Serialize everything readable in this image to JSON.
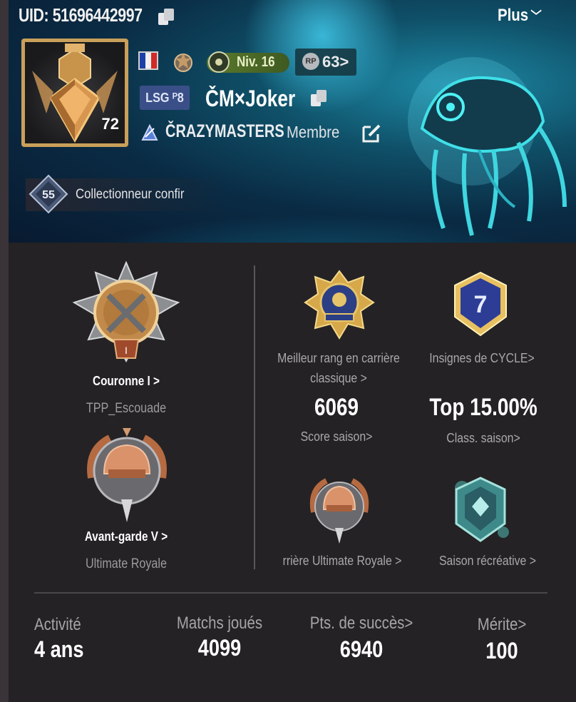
{
  "header": {
    "uid": "UID: 51696442997",
    "more_label": "Plus",
    "avatar_level": "72",
    "level": "Niv. 16",
    "rp": "63>",
    "tag": "LSG ᴾ8",
    "player_name": "ČM×Joker",
    "clan_name": "ČRAZYMASTERS",
    "clan_role": "Membre",
    "collector_level": "55",
    "collector_title": "Collectionneur confir",
    "colors": {
      "flag_blue": "#1f3fa8",
      "flag_white": "#f2f2f2",
      "flag_red": "#d22a2a",
      "level_green": "#5c7a2c",
      "tag_blue": "#3a4f88"
    }
  },
  "left": {
    "rank1": {
      "title": "Couronne I >",
      "mode": "TPP_Escouade"
    },
    "rank2": {
      "title": "Avant-garde V >",
      "mode": "Ultimate Royale"
    }
  },
  "right": {
    "best_rank": {
      "label": "Meilleur rang en carrière classique >"
    },
    "cycle": {
      "label": "Insignes de CYCLE>",
      "number": "7"
    },
    "season_score": {
      "value": "6069",
      "label": "Score saison>"
    },
    "season_rank": {
      "value": "Top 15.00%",
      "label": "Class. saison>"
    },
    "ultimate_career": {
      "label": "rrière Ultimate Royale >"
    },
    "casual_season": {
      "label": "Saison récréative >"
    }
  },
  "footer": {
    "stats": [
      {
        "label": "Activité",
        "value": "4 ans"
      },
      {
        "label": "Matchs joués",
        "value": "4099"
      },
      {
        "label": "Pts. de succès>",
        "value": "6940"
      },
      {
        "label": "Mérite>",
        "value": "100"
      }
    ]
  }
}
